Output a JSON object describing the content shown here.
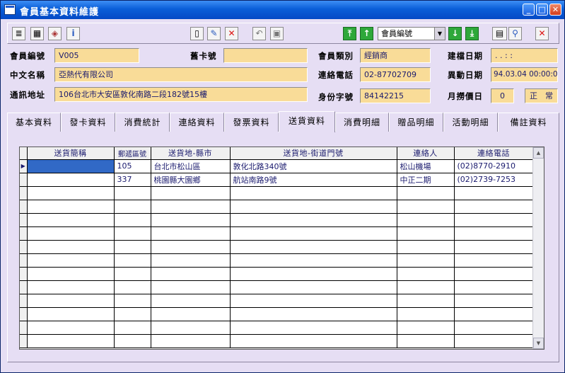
{
  "window": {
    "title": "會員基本資料維護"
  },
  "toolbar": {
    "search_combo_value": "會員編號"
  },
  "form": {
    "member_no_label": "會員編號",
    "member_no": "V005",
    "old_card_label": "舊卡號",
    "old_card": "",
    "member_type_label": "會員類別",
    "member_type": "經銷商",
    "created_label": "建檔日期",
    "created": ". .   : :",
    "cn_name_label": "中文名稱",
    "cn_name": "亞熱代有限公司",
    "phone_label": "連絡電話",
    "phone": "02-87702709",
    "modified_label": "異動日期",
    "modified": "94.03.04 00:00:00",
    "address_label": "通訊地址",
    "address": "106台北市大安區敦化南路二段182號15樓",
    "id_label": "身份字號",
    "id_no": "84142215",
    "month_label": "月撈價日",
    "month_value": "0",
    "status": "正　常"
  },
  "tabs": [
    "基本資料",
    "發卡資料",
    "消費統計",
    "連絡資料",
    "發票資料",
    "送貨資料",
    "消費明細",
    "贈品明細",
    "活動明細",
    "備註資料"
  ],
  "grid": {
    "columns": [
      "送貨簡稱",
      "郵遞區號",
      "送貨地-縣市",
      "送貨地-街道門號",
      "連絡人",
      "連絡電話"
    ],
    "rows": [
      [
        "",
        "105",
        "台北市松山區",
        "敦化北路340號",
        "松山機場",
        "(02)8770-2910"
      ],
      [
        "",
        "337",
        "桃園縣大園鄉",
        "航站南路9號",
        "中正二期",
        "(02)2739-7253"
      ]
    ]
  }
}
